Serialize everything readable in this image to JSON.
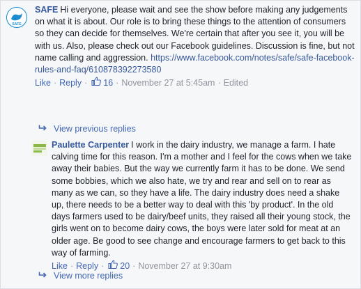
{
  "colors": {
    "link": "#365899",
    "action": "#4267b2",
    "meta": "#90949c",
    "text": "#1d2129",
    "background": "#f6f7f9"
  },
  "comments": [
    {
      "author": "SAFE",
      "avatar_icon": "safe-logo-icon",
      "text": "Hi everyone, please wait and see the show before making any judgements on what it is about. Our role is to bring these things to the attention of consumers so they can decide for themselves. We're certain that after you see it, you will be with us. Also, please check out our Facebook guidelines. Discussion is fine, but not name calling and aggression.",
      "link": "https://www.facebook.com/notes/safe/safe-facebook-rules-and-faq/610878392273580",
      "like_label": "Like",
      "reply_label": "Reply",
      "likes": "16",
      "timestamp": "November 27 at 5:45am",
      "edited": "Edited"
    },
    {
      "author": "Paulette Carpenter",
      "avatar_icon": "profile-photo-icon",
      "text": "I work in the dairy industry, we manage a farm. I hate calving time for this reason. I'm a mother and I feel for the cows when we take away their babies. But the way we currently farm it has to be done. We send some bobbies, which we also hate, we try and rear and sell on to rear as many as we can, so they have a life. The dairy industry does need a shake up, there needs to be a better way to deal with this 'by product'. In the old days farmers used to be dairy/beef units, they raised all their young stock, the girls went on to become dairy cows, the boys were later sold for meat at an older age. Be good to see change and encourage farmers to get back to this way of farming.",
      "like_label": "Like",
      "reply_label": "Reply",
      "likes": "20",
      "timestamp": "November 27 at 9:30am"
    }
  ],
  "view_previous_replies": "View previous replies",
  "view_more_replies": "View more replies",
  "separator": "·"
}
